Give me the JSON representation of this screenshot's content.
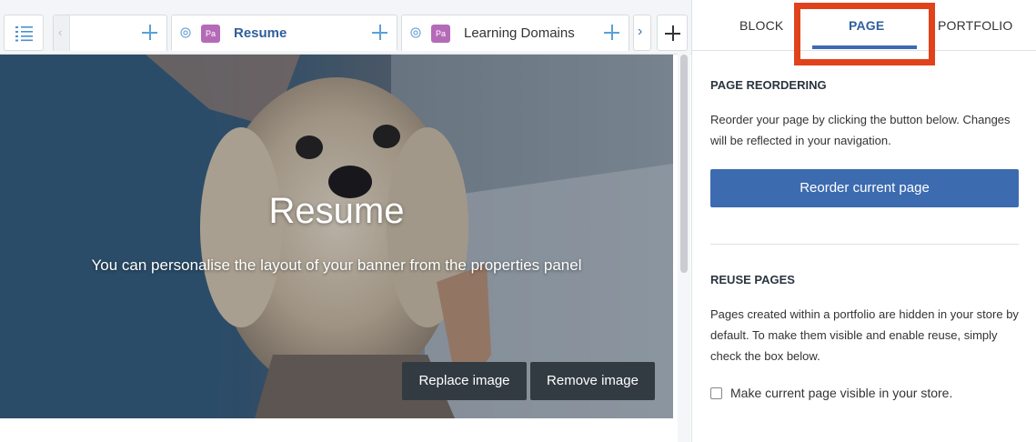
{
  "tabs": [
    {
      "title": "Resume",
      "badge": "Pa",
      "active": true
    },
    {
      "title": "Learning Domains",
      "badge": "Pa",
      "active": false
    }
  ],
  "banner": {
    "title": "Resume",
    "subtitle": "You can personalise the layout of your banner from the properties panel",
    "replace_label": "Replace image",
    "remove_label": "Remove image"
  },
  "panel": {
    "tabs": {
      "block": "BLOCK",
      "page": "PAGE",
      "portfolio": "PORTFOLIO"
    },
    "reorder": {
      "heading": "PAGE REORDERING",
      "text": "Reorder your page by clicking the button below. Changes will be reflected in your navigation.",
      "button_label": "Reorder current page"
    },
    "reuse": {
      "heading": "REUSE PAGES",
      "text": "Pages created within a portfolio are hidden in your store by default. To make them visible and enable reuse, simply check the box below.",
      "checkbox_label": "Make current page visible in your store.",
      "checked": false
    }
  },
  "icons": {
    "page_list": "list-icon",
    "tab_settings": "gear-icon",
    "add": "plus-icon",
    "scroll_right": "chevron-right-icon",
    "scroll_left": "chevron-left-icon"
  },
  "colors": {
    "accent": "#3c6bb0",
    "active_tab_text": "#2f5f9e",
    "badge": "#b56ab8",
    "highlight": "#e0431b",
    "banner_button": "#333b42"
  }
}
